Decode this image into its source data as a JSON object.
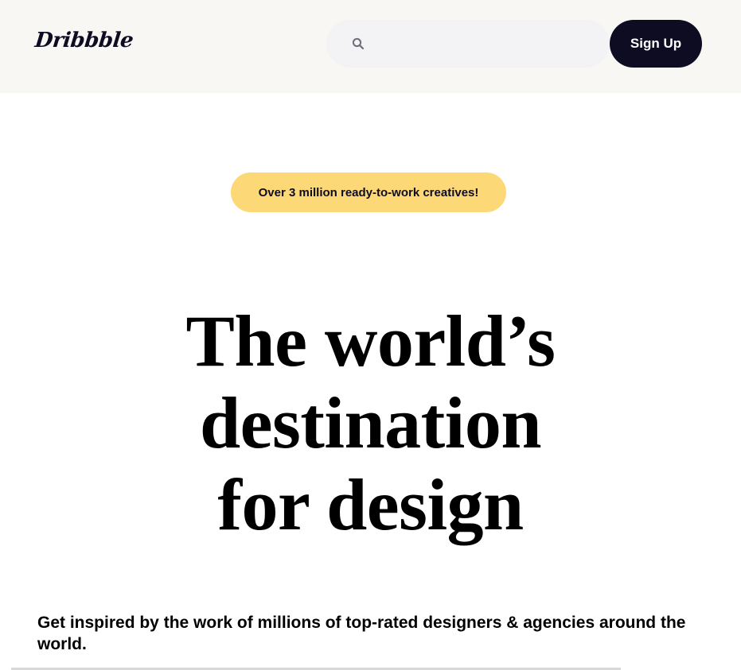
{
  "header": {
    "logo_text": "Dribbble",
    "search": {
      "placeholder": "",
      "value": ""
    },
    "signup_label": "Sign Up"
  },
  "hero": {
    "badge_text": "Over 3 million ready-to-work creatives!",
    "title_lines": [
      "The world’s",
      "destination",
      "for design"
    ],
    "subtitle": "Get inspired by the work of millions of top-rated designers & agencies around the world."
  },
  "colors": {
    "header_bg": "#f8f7f4",
    "search_bg": "#f3f3f6",
    "signup_bg": "#0d0c22",
    "badge_bg": "#fdd877"
  },
  "icons": {
    "search": "search-icon"
  }
}
